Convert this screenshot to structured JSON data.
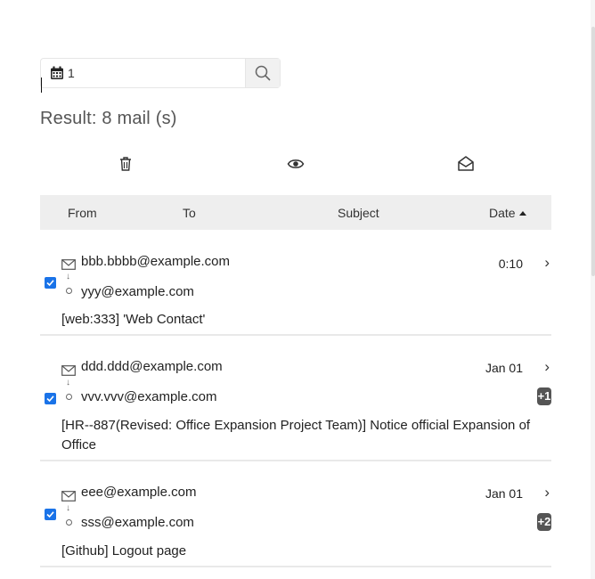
{
  "search": {
    "value": "1"
  },
  "result_title": "Result: 8 mail (s)",
  "toolbar": {
    "delete": "trash-icon",
    "view": "eye-icon",
    "mark_read": "open-envelope-icon"
  },
  "table": {
    "headers": {
      "from": "From",
      "to": "To",
      "subject": "Subject",
      "date": "Date"
    }
  },
  "mails": [
    {
      "from": "bbb.bbbb@example.com",
      "to": "yyy@example.com",
      "subject": "[web:333] 'Web Contact'",
      "date": "0:10",
      "badge": "",
      "checked": true
    },
    {
      "from": "ddd.ddd@example.com",
      "to": "vvv.vvv@example.com",
      "subject": "[HR--887(Revised: Office Expansion Project Team)] Notice official Expansion of Office",
      "date": "Jan 01",
      "badge": "+1",
      "checked": true
    },
    {
      "from": "eee@example.com",
      "to": "sss@example.com",
      "subject": "[Github] Logout page",
      "date": "Jan 01",
      "badge": "+2",
      "checked": true
    }
  ],
  "colors": {
    "accent": "#1a73e8",
    "header_bg": "#eeeeee",
    "badge": "#555555"
  }
}
